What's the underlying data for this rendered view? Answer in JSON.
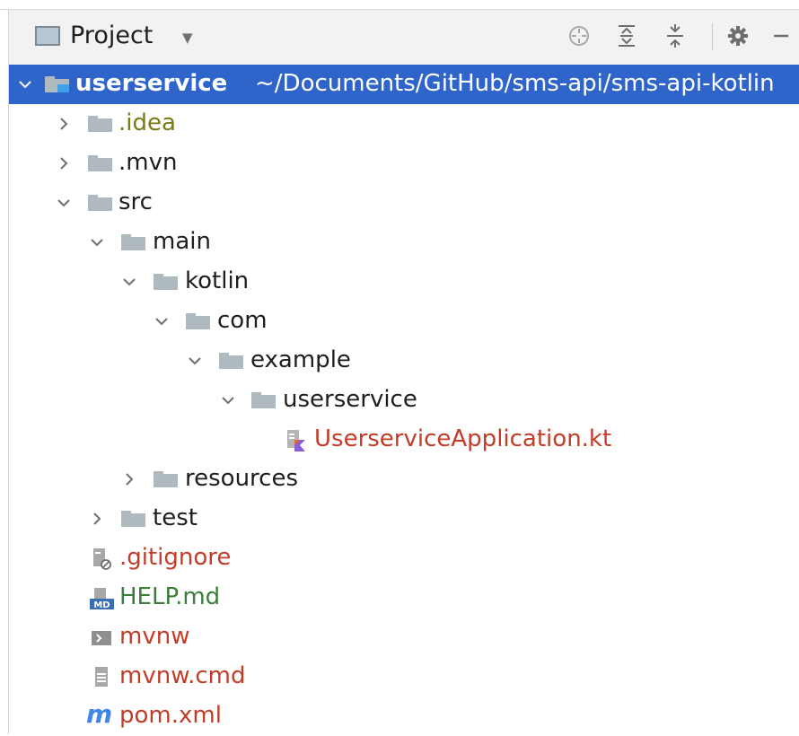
{
  "panel": {
    "title": "Project",
    "toolbar_icons": [
      "locate-icon",
      "expand-all-icon",
      "collapse-all-icon",
      "gear-icon",
      "minimize-icon"
    ]
  },
  "tree": {
    "root": {
      "name": "userservice",
      "path": "~/Documents/GitHub/sms-api/sms-api-kotlin"
    },
    "items": [
      {
        "name": ".idea",
        "type": "folder",
        "color": "#7a7a14"
      },
      {
        "name": ".mvn",
        "type": "folder",
        "color": "#1e1e1e"
      },
      {
        "name": "src",
        "type": "folder",
        "color": "#1e1e1e"
      },
      {
        "name": "main",
        "type": "folder",
        "color": "#1e1e1e"
      },
      {
        "name": "kotlin",
        "type": "folder",
        "color": "#1e1e1e"
      },
      {
        "name": "com",
        "type": "folder",
        "color": "#1e1e1e"
      },
      {
        "name": "example",
        "type": "folder",
        "color": "#1e1e1e"
      },
      {
        "name": "userservice",
        "type": "folder",
        "color": "#1e1e1e"
      },
      {
        "name": "UserserviceApplication.kt",
        "type": "kotlin-file",
        "color": "#c33c28"
      },
      {
        "name": "resources",
        "type": "folder",
        "color": "#1e1e1e"
      },
      {
        "name": "test",
        "type": "folder",
        "color": "#1e1e1e"
      },
      {
        "name": ".gitignore",
        "type": "ignore-file",
        "color": "#c33c28"
      },
      {
        "name": "HELP.md",
        "type": "markdown-file",
        "color": "#3b7d3b"
      },
      {
        "name": "mvnw",
        "type": "shell-file",
        "color": "#c33c28"
      },
      {
        "name": "mvnw.cmd",
        "type": "text-file",
        "color": "#c33c28"
      },
      {
        "name": "pom.xml",
        "type": "maven-file",
        "color": "#c33c28"
      }
    ]
  },
  "colors": {
    "selection": "#2f65ca",
    "folder": "#aeb9c0",
    "modified": "#c33c28",
    "ignored": "#7a7a14",
    "added": "#3b7d3b"
  }
}
